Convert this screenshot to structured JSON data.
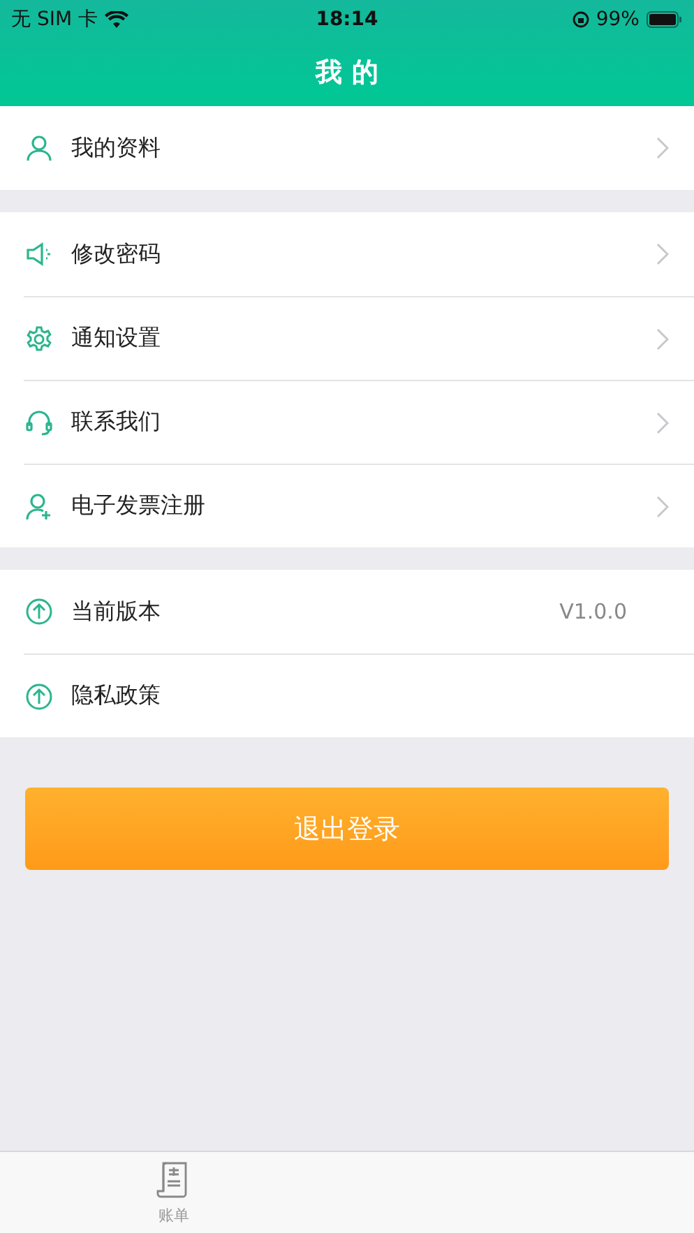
{
  "status_bar": {
    "carrier": "无 SIM 卡",
    "time": "18:14",
    "battery": "99%"
  },
  "header": {
    "title": "我 的"
  },
  "groups": [
    {
      "items": [
        {
          "label": "我的资料",
          "kind": "link"
        }
      ]
    },
    {
      "items": [
        {
          "label": "修改密码",
          "kind": "link"
        },
        {
          "label": "通知设置",
          "kind": "link"
        },
        {
          "label": "联系我们",
          "kind": "link"
        },
        {
          "label": "电子发票注册",
          "kind": "link"
        }
      ]
    },
    {
      "items": [
        {
          "label": "当前版本",
          "kind": "info",
          "value": "V1.0.0"
        },
        {
          "label": "隐私政策",
          "kind": "plain"
        }
      ]
    }
  ],
  "logout_button": "退出登录",
  "tab_bar": {
    "items": [
      {
        "label": "账单"
      }
    ]
  }
}
